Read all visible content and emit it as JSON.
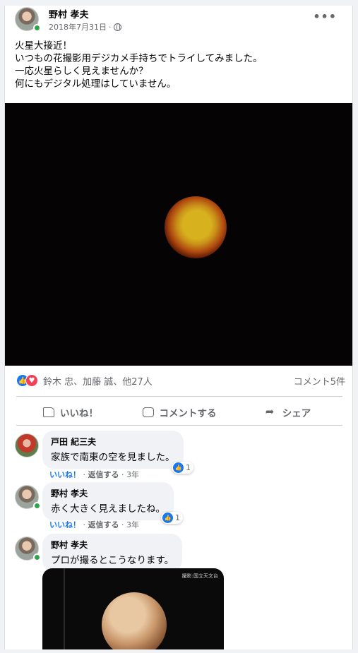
{
  "post": {
    "author": "野村 孝夫",
    "date": "2018年7月31日",
    "meta_separator": "·",
    "more_icon": "more-horizontal-icon",
    "privacy_icon": "globe-icon",
    "text_lines": [
      "火星大接近！",
      "いつもの花撮影用デジカメ手持ちでトライしてみました。",
      "一応火星らしく見えませんか？",
      "何にもデジタル処理はしていません。"
    ],
    "photo_icon": "mars-photo"
  },
  "reactions": {
    "names": "鈴木 忠、加藤 誠、他27人",
    "comments": "コメント5件",
    "icons": [
      "like-icon",
      "love-icon"
    ]
  },
  "actions": {
    "like": "いいね！",
    "comment": "コメントする",
    "share": "シェア"
  },
  "comments": [
    {
      "author": "戸田 紀三夫",
      "text": "家族で南東の空を見ました。",
      "like": "いいね！",
      "reply": "返信する",
      "time": "3年",
      "reaction_count": "1"
    },
    {
      "author": "野村 孝夫",
      "text": "赤く大きく見えましたね。",
      "like": "いいね！",
      "reply": "返信する",
      "time": "3年",
      "reaction_count": "1"
    },
    {
      "author": "野村 孝夫",
      "text": "プロが撮るとこうなります。",
      "photo_caption": "撮影:国立天文台"
    }
  ],
  "colors": {
    "accent": "#1877f2",
    "love": "#f33e58",
    "online": "#31a24c",
    "muted": "#65676b"
  }
}
